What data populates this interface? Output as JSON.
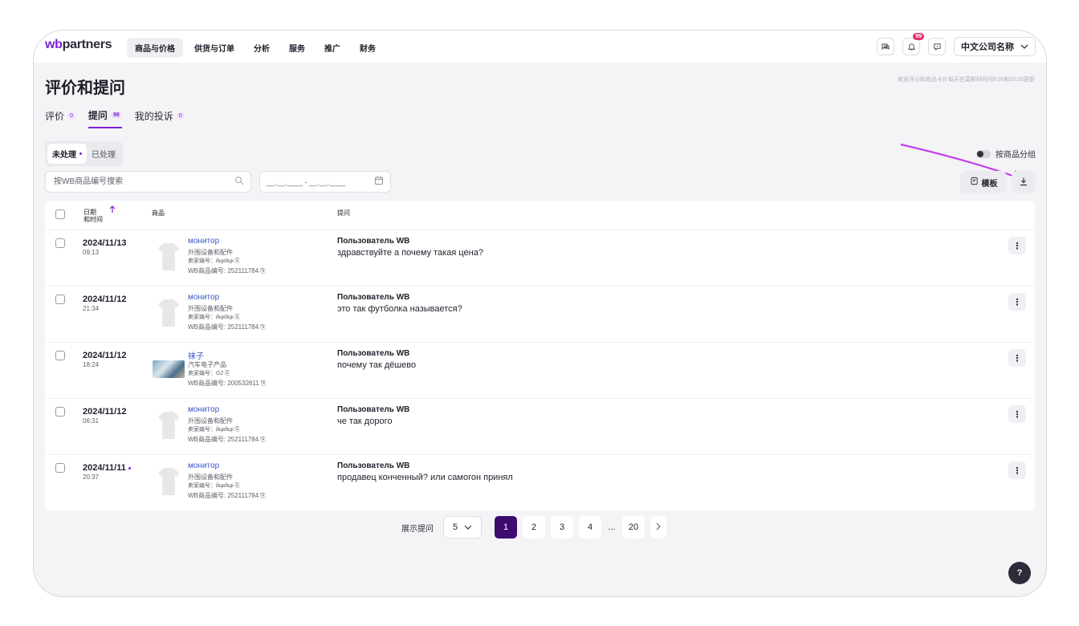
{
  "header": {
    "logo_prefix": "wb",
    "logo_suffix": "partners",
    "nav": [
      "商品与价格",
      "供货与订单",
      "分析",
      "服务",
      "推广",
      "财务"
    ],
    "notifications_count": "99",
    "company_name": "中文公司名称"
  },
  "page": {
    "title": "评价和提问",
    "update_note": "卖家评分和商品卡片每天在莫斯科时间8:00和20:00更新"
  },
  "tabs": [
    {
      "label": "评价",
      "count": "0"
    },
    {
      "label": "提问",
      "count": "98"
    },
    {
      "label": "我的投诉",
      "count": "0"
    }
  ],
  "filter": {
    "unprocessed": "未处理",
    "processed": "已处理",
    "group_by_product": "按商品分组",
    "search_placeholder": "按WB商品编号搜索",
    "date_placeholder": "__.__.____ - __.__.____",
    "template_label": "模板"
  },
  "table": {
    "columns": {
      "date_line1": "日期",
      "date_line2": "和时间",
      "product": "商品",
      "question": "提问"
    },
    "rows": [
      {
        "date": "2024/11/13",
        "time": "09:13",
        "product_name": "монитор",
        "category": "外围设备和配件",
        "seller_code": "卖家编号：йцкйцк",
        "wb_code": "WB商品编号: 252111784",
        "author": "Пользователь WB",
        "question": "здравствуйте а почему такая цена?",
        "thumb": "tshirt",
        "is_new": false
      },
      {
        "date": "2024/11/12",
        "time": "21:34",
        "product_name": "монитор",
        "category": "外围设备和配件",
        "seller_code": "卖家编号：йцкйцк",
        "wb_code": "WB商品编号: 252111784",
        "author": "Пользователь WB",
        "question": "это так футболка называется?",
        "thumb": "tshirt",
        "is_new": false
      },
      {
        "date": "2024/11/12",
        "time": "18:24",
        "product_name": "袜子",
        "category": "汽车电子产品",
        "seller_code": "卖家编号：G2",
        "wb_code": "WB商品编号: 200532611",
        "author": "Пользователь WB",
        "question": "почему так дёшево",
        "thumb": "photo",
        "is_new": false
      },
      {
        "date": "2024/11/12",
        "time": "06:31",
        "product_name": "монитор",
        "category": "外围设备和配件",
        "seller_code": "卖家编号：йцкйцк",
        "wb_code": "WB商品编号: 252111784",
        "author": "Пользователь WB",
        "question": "че так дорого",
        "thumb": "tshirt",
        "is_new": false
      },
      {
        "date": "2024/11/11",
        "time": "20:37",
        "product_name": "монитор",
        "category": "外围设备和配件",
        "seller_code": "卖家编号：йцкйцк",
        "wb_code": "WB商品编号: 252111784",
        "author": "Пользователь WB",
        "question": "продавец конченный? или самогон принял",
        "thumb": "tshirt",
        "is_new": true
      }
    ]
  },
  "pagination": {
    "label": "展示提问",
    "page_size": "5",
    "pages": [
      "1",
      "2",
      "3",
      "4"
    ],
    "ellipsis": "...",
    "last_page": "20",
    "current": "1"
  },
  "help_label": "?",
  "colors": {
    "accent": "#7b23d6",
    "active_page": "#3d0b6e",
    "link": "#3a55c8"
  }
}
